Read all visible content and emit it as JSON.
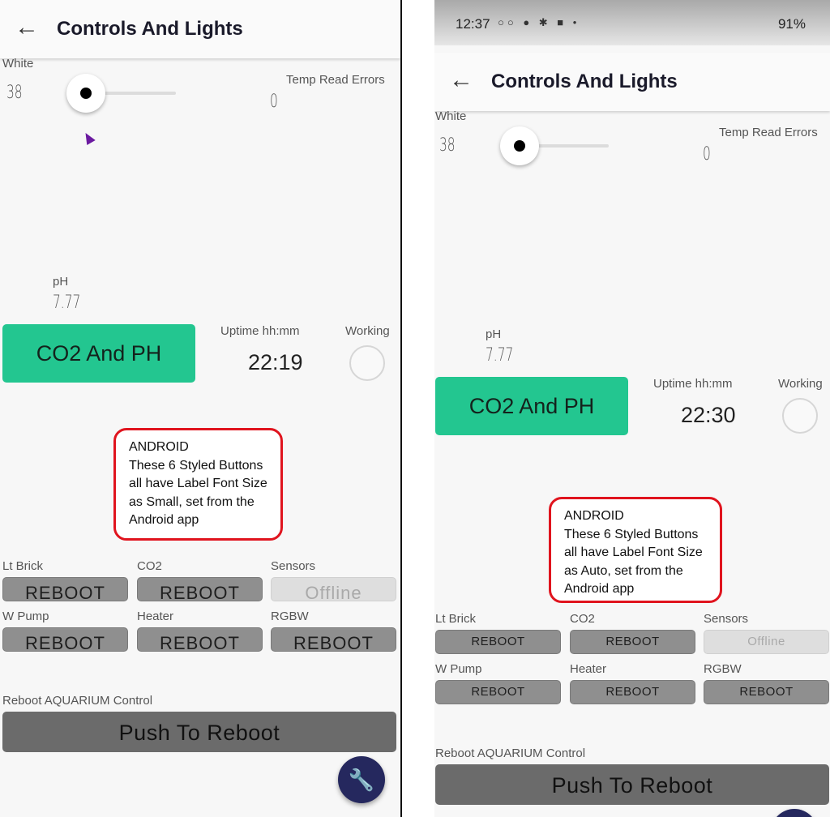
{
  "left": {
    "title": "Controls And Lights",
    "white_label": "White",
    "white_value": "38",
    "temp_label": "Temp Read Errors",
    "temp_value": "0",
    "ph_label": "pH",
    "ph_value": "7.77",
    "co2_button": "CO2 And PH",
    "uptime_label": "Uptime hh:mm",
    "uptime_value": "22:19",
    "working_label": "Working",
    "callout": [
      "ANDROID",
      "These 6 Styled Buttons",
      "all have Label Font Size",
      "as Small, set from the",
      "Android app"
    ],
    "buttons": [
      {
        "label": "Lt Brick",
        "text": "REBOOT"
      },
      {
        "label": "CO2",
        "text": "REBOOT"
      },
      {
        "label": "Sensors",
        "text": "Offline"
      },
      {
        "label": "W Pump",
        "text": "REBOOT"
      },
      {
        "label": "Heater",
        "text": "REBOOT"
      },
      {
        "label": "RGBW",
        "text": "REBOOT"
      }
    ],
    "reboot_label": "Reboot AQUARIUM Control",
    "reboot_button": "Push To Reboot"
  },
  "right": {
    "status_time": "12:37",
    "battery": "91%",
    "title": "Controls And Lights",
    "white_label": "White",
    "white_value": "38",
    "temp_label": "Temp Read Errors",
    "temp_value": "0",
    "ph_label": "pH",
    "ph_value": "7.77",
    "co2_button": "CO2 And PH",
    "uptime_label": "Uptime hh:mm",
    "uptime_value": "22:30",
    "working_label": "Working",
    "callout": [
      "ANDROID",
      "These 6 Styled Buttons",
      "all have Label Font Size",
      "as Auto, set from the",
      "Android app"
    ],
    "buttons": [
      {
        "label": "Lt Brick",
        "text": "REBOOT"
      },
      {
        "label": "CO2",
        "text": "REBOOT"
      },
      {
        "label": "Sensors",
        "text": "Offline"
      },
      {
        "label": "W Pump",
        "text": "REBOOT"
      },
      {
        "label": "Heater",
        "text": "REBOOT"
      },
      {
        "label": "RGBW",
        "text": "REBOOT"
      }
    ],
    "reboot_label": "Reboot AQUARIUM Control",
    "reboot_button": "Push To Reboot"
  },
  "icons": {
    "back": "arrow-left-icon",
    "fab": "wrench-icon",
    "cursor": "mouse-cursor-icon"
  },
  "colors": {
    "accent_green": "#23c690",
    "fab_navy": "#25285e",
    "callout_red": "#e0141e"
  }
}
